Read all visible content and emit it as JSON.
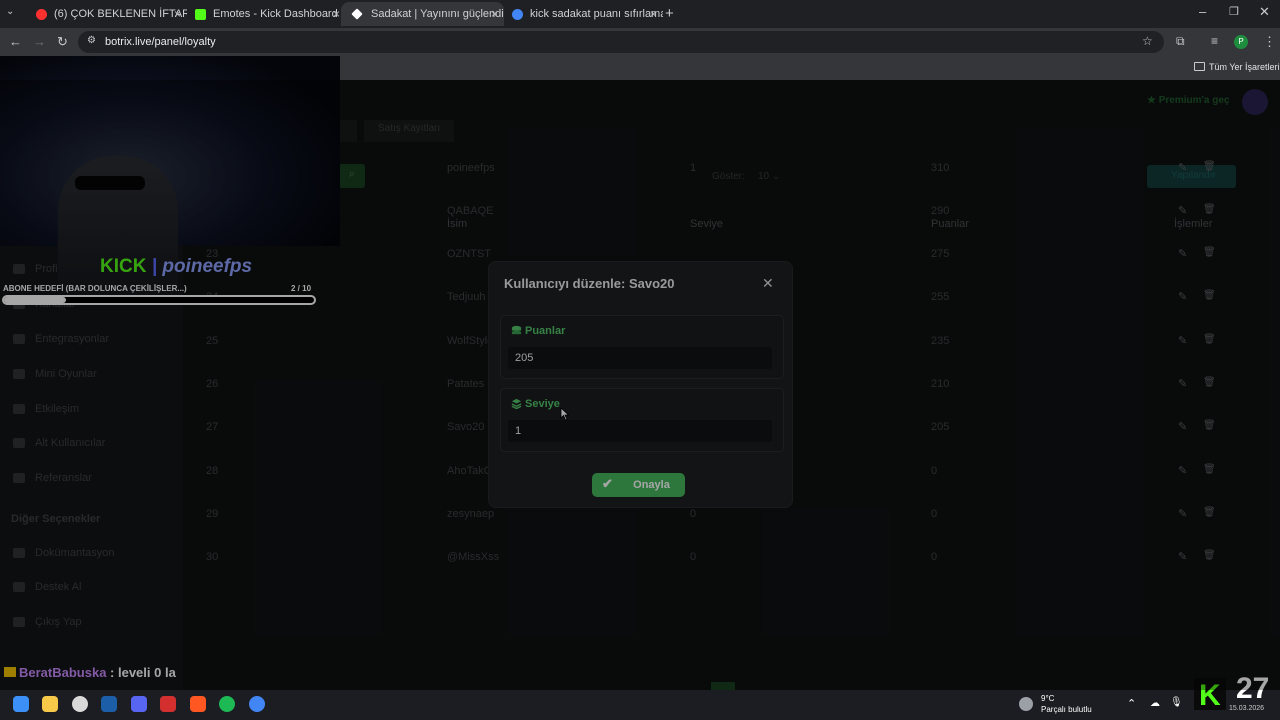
{
  "browser": {
    "tabs": [
      {
        "label": "(6) ÇOK BEKLENEN İFTAR! | Alp",
        "color": "#ff3030"
      },
      {
        "label": "Emotes - Kick Dashboard",
        "color": "#53fc18"
      },
      {
        "label": "Sadakat | Yayınını güçlendirme",
        "color": "#ffffff"
      },
      {
        "label": "kick sadakat puanı sıfırlama - G",
        "color": "#4285f4"
      }
    ],
    "url": "botrix.live/panel/loyalty",
    "bookmarks_label": "Tüm Yer İşaretleri",
    "profile_initial": "P"
  },
  "page": {
    "premium_label": "Premium'a geç",
    "tab_sales": "Satış Kayıtları",
    "show_label": "Göster:",
    "show_value": "10",
    "export_label": "Yapılandır",
    "columns": [
      "İsim",
      "Seviye",
      "Puanlar",
      "İşlemler"
    ],
    "rows": [
      {
        "rank": "",
        "name": "poineefps",
        "level": "1",
        "points": "310"
      },
      {
        "rank": "22",
        "name": "QABAQE",
        "level": "",
        "points": "290"
      },
      {
        "rank": "23",
        "name": "OZNTST",
        "level": "",
        "points": "275"
      },
      {
        "rank": "24",
        "name": "Tedjuuh",
        "level": "",
        "points": "255"
      },
      {
        "rank": "25",
        "name": "WolfStyle",
        "level": "",
        "points": "235"
      },
      {
        "rank": "26",
        "name": "Patates",
        "level": "",
        "points": "210"
      },
      {
        "rank": "27",
        "name": "Savo20",
        "level": "1",
        "points": "205"
      },
      {
        "rank": "28",
        "name": "AhoTakO",
        "level": "0",
        "points": "0"
      },
      {
        "rank": "29",
        "name": "zesynaep",
        "level": "0",
        "points": "0"
      },
      {
        "rank": "30",
        "name": "@MissXss",
        "level": "0",
        "points": "0"
      }
    ],
    "sidebar": [
      "Profil",
      "Kanallar",
      "Entegrasyonlar",
      "Mini Oyunlar",
      "Etkileşim",
      "Alt Kullanıcılar"
    ],
    "sidebar_extra": [
      "Referanslar"
    ],
    "other_title": "Diğer Seçenekler",
    "other_items": [
      "Dokümantasyon",
      "Destek Al",
      "Çıkış Yap"
    ]
  },
  "modal": {
    "title": "Kullanıcıyı düzenle: Savo20",
    "points_label": "Puanlar",
    "points_value": "205",
    "level_label": "Seviye",
    "level_value": "1",
    "confirm_label": "Onayla"
  },
  "stream_overlay": {
    "platform": "KICK",
    "channel": "poineefps",
    "goal_label": "ABONE HEDEFİ (BAR DOLUNCA ÇEKİLİŞLER...)",
    "goal_current": 2,
    "goal_max": 10,
    "goal_count_text": "2  / 10",
    "chat_user": "BeratBabuska",
    "chat_text": " : leveli 0 la",
    "badge_number": "27"
  },
  "taskbar": {
    "weather_temp": "9°C",
    "weather_desc": "Parçalı bulutlu",
    "date": "15.03.2026"
  },
  "colors": {
    "accent": "#45b75d",
    "label_green": "#53c76a",
    "kick_green": "#53fc18",
    "modal_bg": "#1e2022"
  }
}
